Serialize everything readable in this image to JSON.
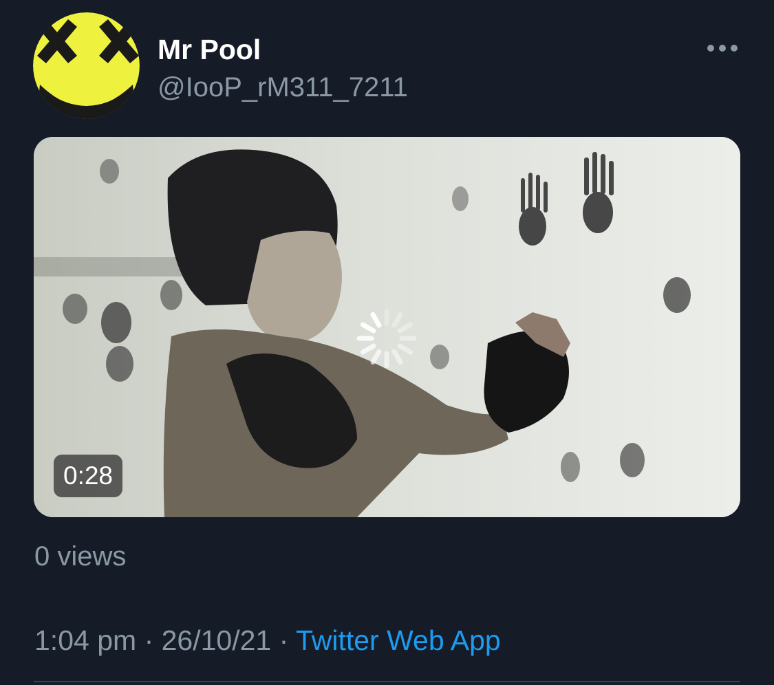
{
  "tweet": {
    "author": {
      "display_name": "Mr Pool",
      "handle": "@IooP_rM311_7211",
      "avatar_icon": "yellow-smiley-face-icon"
    },
    "more_icon": "more-options-icon",
    "media": {
      "type": "video",
      "duration": "0:28",
      "loading_icon": "loading-spinner-icon"
    },
    "views": "0 views",
    "meta": {
      "time": "1:04 pm",
      "separator": "·",
      "date": "26/10/21",
      "source": "Twitter Web App"
    }
  },
  "colors": {
    "background": "#151c28",
    "primary_text": "#ffffff",
    "secondary_text": "#8b98a5",
    "link": "#1d9bf0",
    "avatar_yellow": "#eef23e"
  }
}
